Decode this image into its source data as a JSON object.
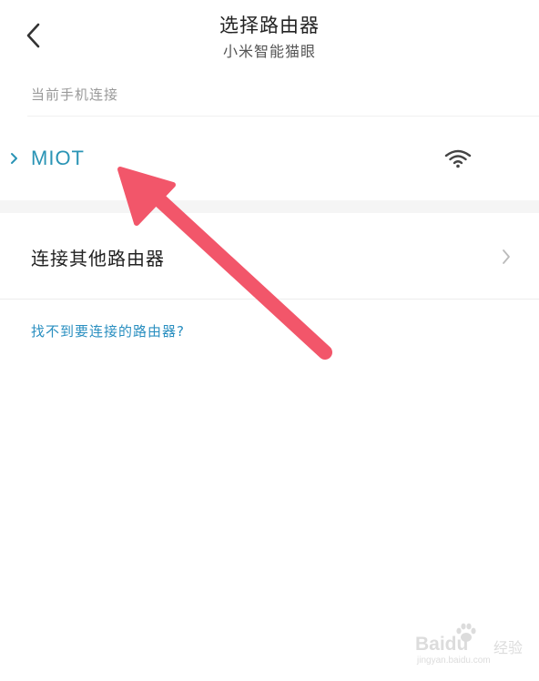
{
  "header": {
    "title": "选择路由器",
    "subtitle": "小米智能猫眼"
  },
  "current": {
    "section_label": "当前手机连接",
    "network_name": "MIOT"
  },
  "other": {
    "label": "连接其他路由器"
  },
  "help": {
    "link": "找不到要连接的路由器?"
  },
  "watermark": {
    "brand": "Baidu",
    "suffix": "经验",
    "url": "jingyan.baidu.com"
  },
  "colors": {
    "accent_blue": "#2a94b5",
    "annotation_arrow": "#f2566a"
  }
}
